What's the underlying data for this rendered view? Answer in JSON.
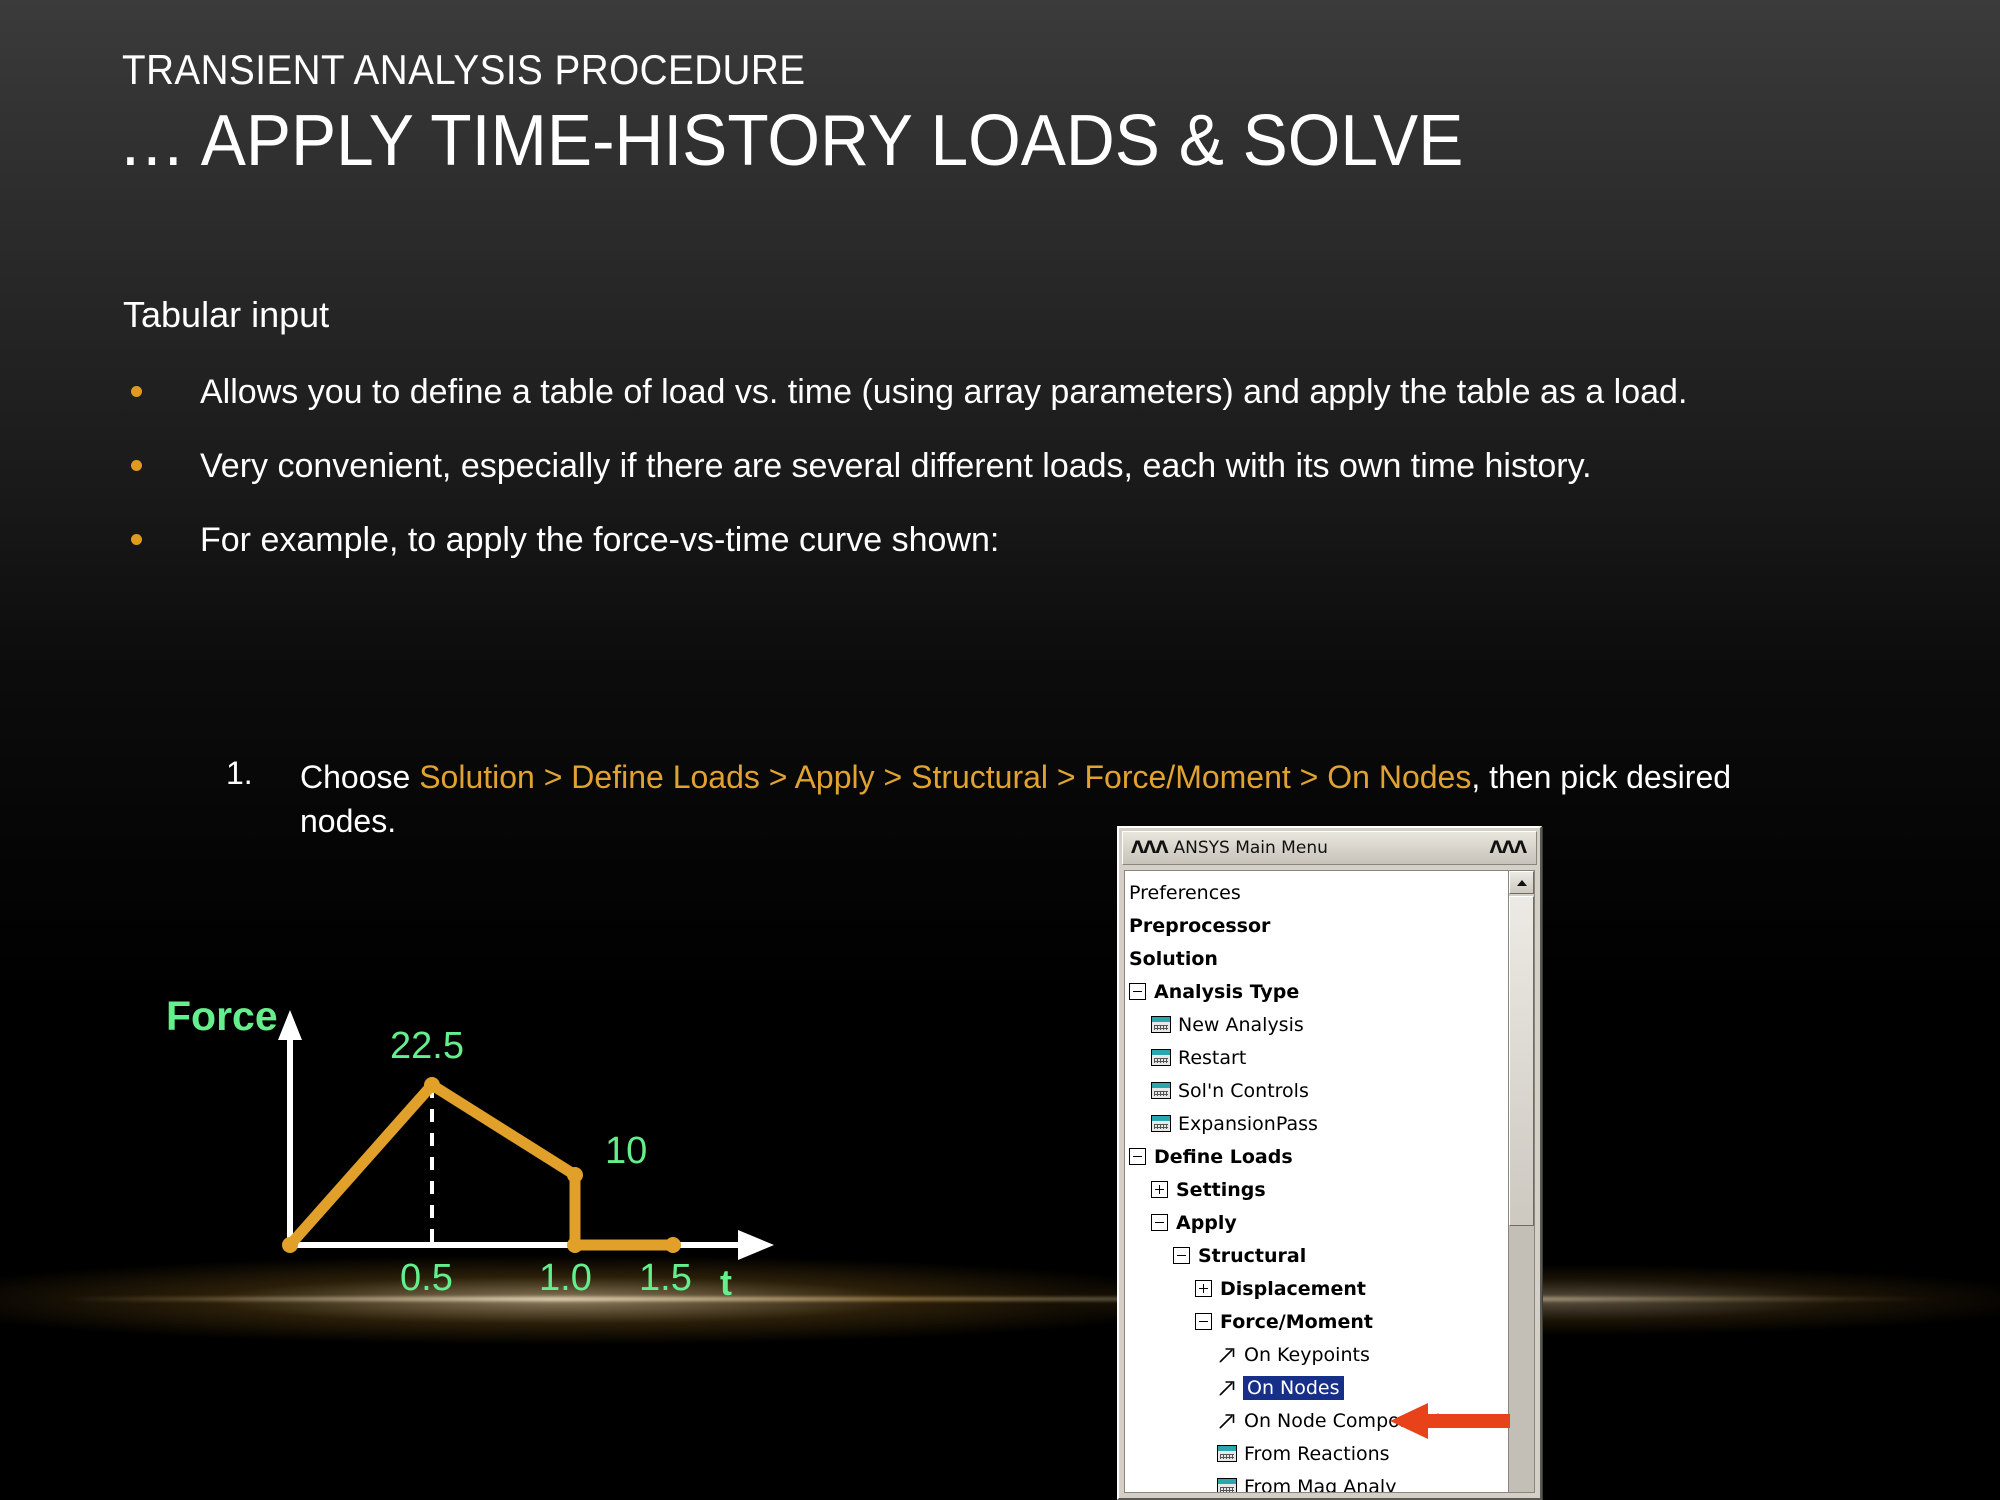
{
  "slide": {
    "kicker": "TRANSIENT ANALYSIS PROCEDURE",
    "headline": "… APPLY TIME-HISTORY LOADS & SOLVE",
    "lead": "Tabular input",
    "bullets": [
      "Allows you to define a table of load vs. time (using array parameters) and apply the table as a load.",
      "Very convenient, especially if there are several different loads, each with its own time history.",
      "For example, to apply the force-vs-time curve shown:"
    ],
    "numbered": [
      {
        "num": "1.",
        "prefix": "Choose ",
        "path": "Solution > Define Loads > Apply > Structural > Force/Moment > On Nodes",
        "suffix": ", then pick desired nodes."
      }
    ],
    "colors": {
      "bullet": "#e09a20",
      "menu_path": "#e0a230",
      "text": "#ffffff",
      "plot_curve": "#e0a02a",
      "plot_label": "#64ef8d"
    }
  },
  "chart_data": {
    "type": "line",
    "title": "",
    "xlabel": "t",
    "ylabel": "Force",
    "x": [
      0,
      0.5,
      1.0,
      1.0,
      1.5
    ],
    "y": [
      0,
      22.5,
      10,
      0,
      0
    ],
    "xticks": [
      "0.5",
      "1.0",
      "1.5"
    ],
    "xtick_values": [
      0.5,
      1.0,
      1.5
    ],
    "point_labels": [
      "22.5",
      "10"
    ],
    "point_label_values": [
      22.5,
      10
    ],
    "xlim": [
      0,
      1.75
    ],
    "ylim": [
      0,
      26
    ],
    "grid": false,
    "legend": null,
    "annotations": [
      "dashed vertical guide line at t = 0.5 up to Force = 22.5"
    ],
    "curve_color": "#e0a02a",
    "axis_color": "#ffffff",
    "label_color": "#64ef8d"
  },
  "ansys_menu": {
    "title": "ANSYS Main Menu",
    "title_ornament_left": "ΛΛΛ",
    "title_ornament_right": "ΛΛΛ",
    "items": [
      {
        "label": "Preferences",
        "indent": 0,
        "bold": false,
        "marker": "none",
        "selected": false
      },
      {
        "label": "Preprocessor",
        "indent": 0,
        "bold": true,
        "marker": "none",
        "selected": false
      },
      {
        "label": "Solution",
        "indent": 0,
        "bold": true,
        "marker": "none",
        "selected": false
      },
      {
        "label": "Analysis Type",
        "indent": 0,
        "bold": true,
        "marker": "minus",
        "selected": false
      },
      {
        "label": "New Analysis",
        "indent": 1,
        "bold": false,
        "marker": "dialog",
        "selected": false
      },
      {
        "label": "Restart",
        "indent": 1,
        "bold": false,
        "marker": "dialog",
        "selected": false
      },
      {
        "label": "Sol'n Controls",
        "indent": 1,
        "bold": false,
        "marker": "dialog",
        "selected": false
      },
      {
        "label": "ExpansionPass",
        "indent": 1,
        "bold": false,
        "marker": "dialog",
        "selected": false
      },
      {
        "label": "Define Loads",
        "indent": 0,
        "bold": true,
        "marker": "minus",
        "selected": false
      },
      {
        "label": "Settings",
        "indent": 1,
        "bold": true,
        "marker": "plus",
        "selected": false
      },
      {
        "label": "Apply",
        "indent": 1,
        "bold": true,
        "marker": "minus",
        "selected": false
      },
      {
        "label": "Structural",
        "indent": 2,
        "bold": true,
        "marker": "minus",
        "selected": false
      },
      {
        "label": "Displacement",
        "indent": 3,
        "bold": true,
        "marker": "plus",
        "selected": false
      },
      {
        "label": "Force/Moment",
        "indent": 3,
        "bold": true,
        "marker": "minus",
        "selected": false
      },
      {
        "label": "On Keypoints",
        "indent": 4,
        "bold": false,
        "marker": "pick",
        "selected": false
      },
      {
        "label": "On Nodes",
        "indent": 4,
        "bold": false,
        "marker": "pick",
        "selected": true
      },
      {
        "label": "On Node Components",
        "indent": 4,
        "bold": false,
        "marker": "pick",
        "selected": false
      },
      {
        "label": "From Reactions",
        "indent": 4,
        "bold": false,
        "marker": "dialog",
        "selected": false
      },
      {
        "label": "From Mag Analy",
        "indent": 4,
        "bold": false,
        "marker": "dialog",
        "selected": false
      }
    ],
    "highlight_color": "#16308a",
    "pointer_arrow_color": "#e8421a",
    "scrollbar": {
      "up_arrow": "▲"
    }
  }
}
